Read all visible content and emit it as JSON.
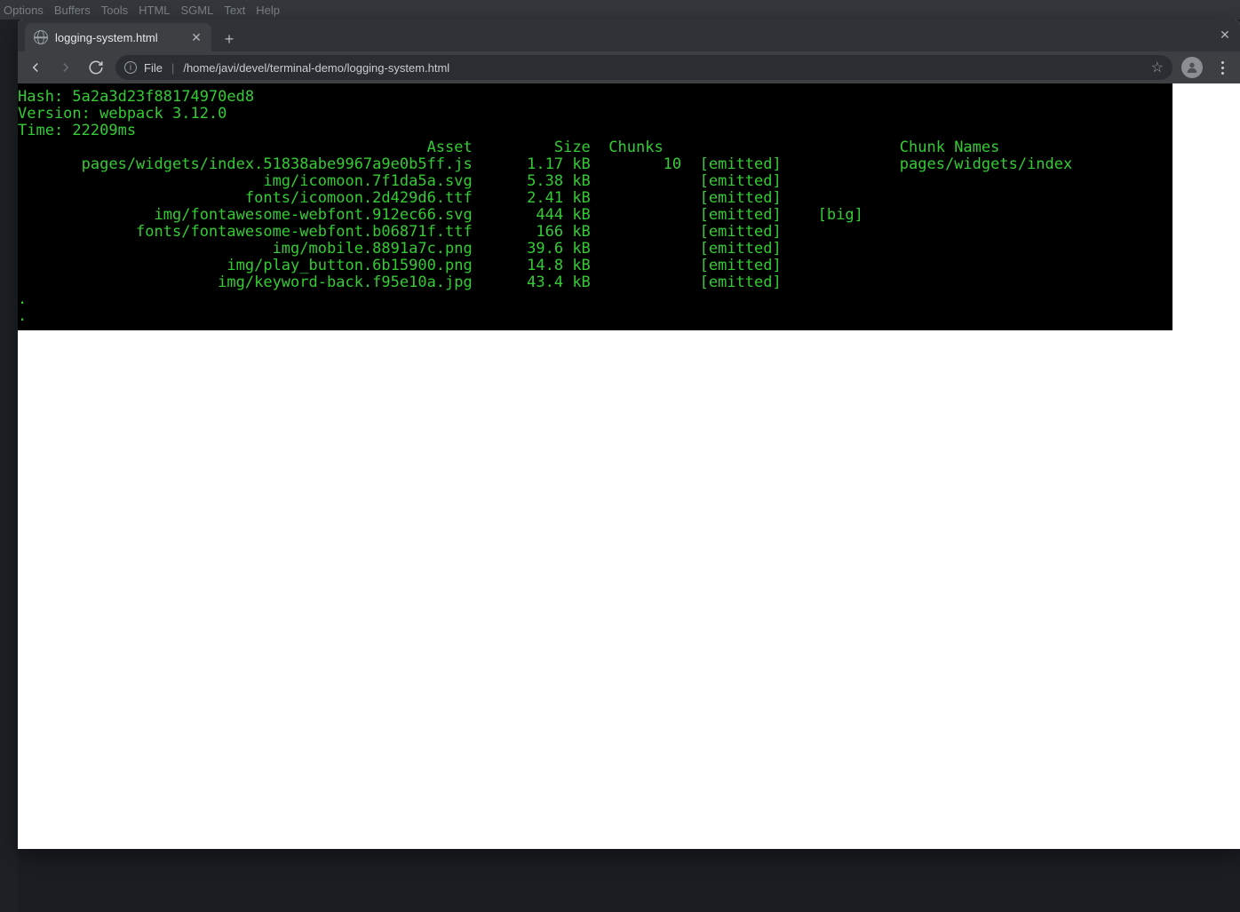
{
  "bg_menu": [
    "Options",
    "Buffers",
    "Tools",
    "HTML",
    "SGML",
    "Text",
    "Help"
  ],
  "tab": {
    "title": "logging-system.html"
  },
  "address": {
    "scheme": "File",
    "path": "/home/javi/devel/terminal-demo/logging-system.html"
  },
  "terminal": {
    "hash_label": "Hash:",
    "hash": "5a2a3d23f88174970ed8",
    "version_label": "Version:",
    "version": "webpack 3.12.0",
    "time_label": "Time:",
    "time": "22209ms",
    "headers": {
      "asset": "Asset",
      "size": "Size",
      "chunks": "Chunks",
      "chunk_names": "Chunk Names"
    },
    "rows": [
      {
        "asset": "pages/widgets/index.51838abe9967a9e0b5ff.js",
        "size": "1.17 kB",
        "chunks": "10",
        "flags": "[emitted]",
        "extra": "",
        "chunk_names": "pages/widgets/index"
      },
      {
        "asset": "img/icomoon.7f1da5a.svg",
        "size": "5.38 kB",
        "chunks": "",
        "flags": "[emitted]",
        "extra": "",
        "chunk_names": ""
      },
      {
        "asset": "fonts/icomoon.2d429d6.ttf",
        "size": "2.41 kB",
        "chunks": "",
        "flags": "[emitted]",
        "extra": "",
        "chunk_names": ""
      },
      {
        "asset": "img/fontawesome-webfont.912ec66.svg",
        "size": "444 kB",
        "chunks": "",
        "flags": "[emitted]",
        "extra": "[big]",
        "chunk_names": ""
      },
      {
        "asset": "fonts/fontawesome-webfont.b06871f.ttf",
        "size": "166 kB",
        "chunks": "",
        "flags": "[emitted]",
        "extra": "",
        "chunk_names": ""
      },
      {
        "asset": "img/mobile.8891a7c.png",
        "size": "39.6 kB",
        "chunks": "",
        "flags": "[emitted]",
        "extra": "",
        "chunk_names": ""
      },
      {
        "asset": "img/play_button.6b15900.png",
        "size": "14.8 kB",
        "chunks": "",
        "flags": "[emitted]",
        "extra": "",
        "chunk_names": ""
      },
      {
        "asset": "img/keyword-back.f95e10a.jpg",
        "size": "43.4 kB",
        "chunks": "",
        "flags": "[emitted]",
        "extra": "",
        "chunk_names": ""
      }
    ],
    "trailing": [
      ".",
      "."
    ]
  }
}
